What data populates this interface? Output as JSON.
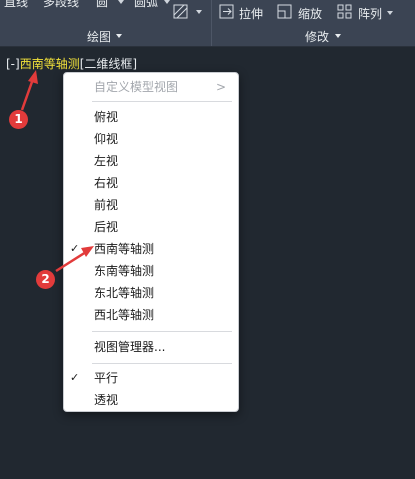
{
  "ribbon": {
    "top_labels": [
      "直线",
      "多段线",
      "圆",
      "圆弧"
    ],
    "modify_buttons": [
      {
        "label": "拉伸",
        "icon": "stretch-icon"
      },
      {
        "label": "缩放",
        "icon": "scale-icon"
      },
      {
        "label": "阵列",
        "icon": "array-icon"
      }
    ],
    "panels": [
      {
        "label": "绘图",
        "icon": "chevron-down-icon"
      },
      {
        "label": "修改",
        "icon": "chevron-down-icon"
      }
    ]
  },
  "viewport": {
    "control": "[-]",
    "view": "西南等轴测",
    "visual_style": "[二维线框]"
  },
  "menu": {
    "custom_views": {
      "label": "自定义模型视图",
      "disabled": true
    },
    "views": [
      {
        "label": "俯视",
        "checked": false
      },
      {
        "label": "仰视",
        "checked": false
      },
      {
        "label": "左视",
        "checked": false
      },
      {
        "label": "右视",
        "checked": false
      },
      {
        "label": "前视",
        "checked": false
      },
      {
        "label": "后视",
        "checked": false
      },
      {
        "label": "西南等轴测",
        "checked": true
      },
      {
        "label": "东南等轴测",
        "checked": false
      },
      {
        "label": "东北等轴测",
        "checked": false
      },
      {
        "label": "西北等轴测",
        "checked": false
      }
    ],
    "view_manager": "视图管理器...",
    "projection": [
      {
        "label": "平行",
        "checked": true
      },
      {
        "label": "透视",
        "checked": false
      }
    ],
    "check_mark": "✓",
    "submenu_arrow": ">"
  },
  "annotations": {
    "marker1": "1",
    "marker2": "2",
    "color": "#e23b3b"
  }
}
